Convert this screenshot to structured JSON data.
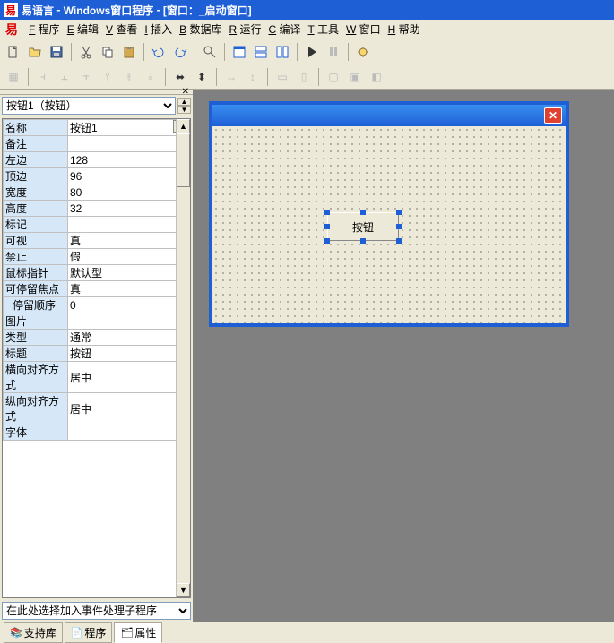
{
  "title_app": "易语言",
  "title_proj": "Windows窗口程序",
  "title_win": "[窗口：_启动窗口]",
  "menus": [
    {
      "u": "F",
      "t": " 程序"
    },
    {
      "u": "E",
      "t": " 编辑"
    },
    {
      "u": "V",
      "t": " 查看"
    },
    {
      "u": "I",
      "t": " 插入"
    },
    {
      "u": "B",
      "t": " 数据库"
    },
    {
      "u": "R",
      "t": " 运行"
    },
    {
      "u": "C",
      "t": " 编译"
    },
    {
      "u": "T",
      "t": " 工具"
    },
    {
      "u": "W",
      "t": " 窗口"
    },
    {
      "u": "H",
      "t": " 帮助"
    }
  ],
  "selector": "按钮1（按钮）",
  "properties": [
    {
      "label": "名称",
      "value": "按钮1",
      "dots": true,
      "sel": true
    },
    {
      "label": "备注",
      "value": ""
    },
    {
      "label": "左边",
      "value": "128"
    },
    {
      "label": "顶边",
      "value": "96"
    },
    {
      "label": "宽度",
      "value": "80"
    },
    {
      "label": "高度",
      "value": "32"
    },
    {
      "label": "标记",
      "value": ""
    },
    {
      "label": "可视",
      "value": "真"
    },
    {
      "label": "禁止",
      "value": "假"
    },
    {
      "label": "鼠标指针",
      "value": "默认型"
    },
    {
      "label": "可停留焦点",
      "value": "真"
    },
    {
      "label": "停留顺序",
      "value": "0",
      "indent": true
    },
    {
      "label": "图片",
      "value": ""
    },
    {
      "label": "类型",
      "value": "通常"
    },
    {
      "label": "标题",
      "value": "按钮"
    },
    {
      "label": "横向对齐方式",
      "value": "居中"
    },
    {
      "label": "纵向对齐方式",
      "value": "居中"
    },
    {
      "label": "字体",
      "value": ""
    }
  ],
  "event_selector": "在此处选择加入事件处理子程序",
  "tabs": {
    "support": "支持库",
    "program": "程序",
    "property": "属性"
  },
  "button_caption": "按钮"
}
